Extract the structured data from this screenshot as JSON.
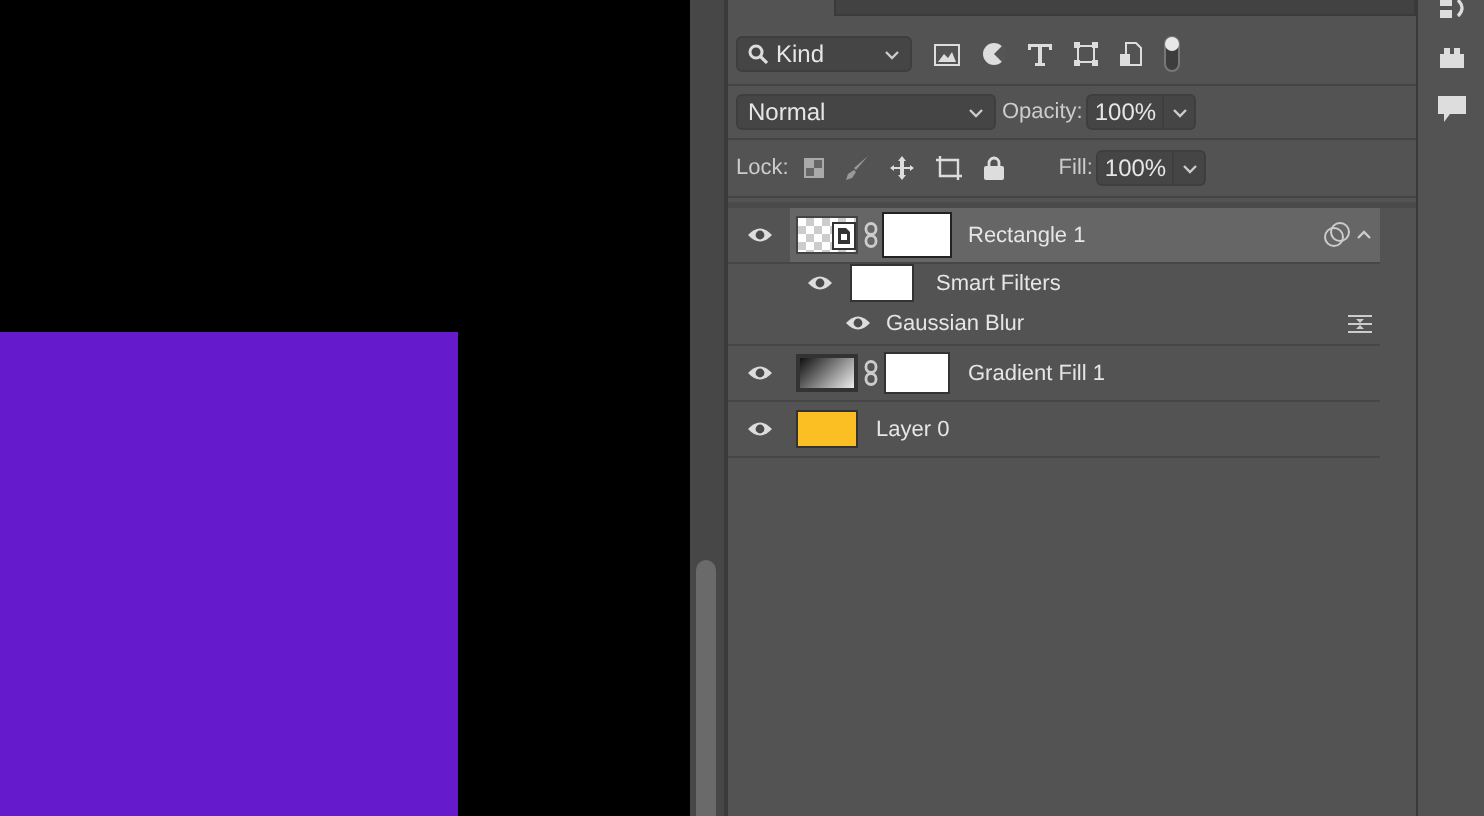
{
  "filter_bar": {
    "kind_label": "Kind"
  },
  "blend_row": {
    "mode": "Normal",
    "opacity_label": "Opacity:",
    "opacity": "100%"
  },
  "lock_row": {
    "lock_label": "Lock:",
    "fill_label": "Fill:",
    "fill": "100%"
  },
  "layers": [
    {
      "name": "Rectangle 1",
      "kind": "smart",
      "selected": true,
      "visible": true,
      "expanded": true,
      "children": [
        {
          "name": "Smart Filters",
          "kind": "filters",
          "visible": true,
          "children": [
            {
              "name": "Gaussian Blur",
              "kind": "filter",
              "visible": true
            }
          ]
        }
      ]
    },
    {
      "name": "Gradient Fill 1",
      "kind": "gradient",
      "selected": false,
      "visible": true
    },
    {
      "name": "Layer 0",
      "kind": "pixel",
      "selected": false,
      "visible": true
    }
  ]
}
